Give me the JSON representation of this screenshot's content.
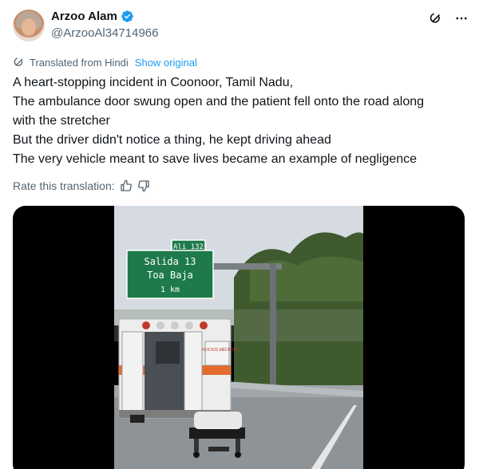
{
  "author": {
    "display_name": "Arzoo Alam",
    "handle": "@ArzooAl34714966",
    "avatar_icon": "avatar-photo",
    "verified_icon": "verified-badge-icon",
    "verified_color": "#1d9bf0"
  },
  "translation": {
    "label": "Translated from Hindi",
    "show_original": "Show original",
    "icon": "translate-icon"
  },
  "tweet": {
    "lines": [
      "A heart-stopping incident in Coonoor, Tamil Nadu,",
      "The ambulance door swung open and the patient fell onto the road along",
      "with the stretcher",
      "But the driver didn't notice a thing, he kept driving ahead",
      "The very vehicle meant to save lives became an example of negligence"
    ]
  },
  "rating": {
    "label": "Rate this translation:",
    "thumbs_up_icon": "thumbs-up-icon",
    "thumbs_down_icon": "thumbs-down-icon"
  },
  "media": {
    "sign": {
      "exit_tag": "Ali 132",
      "line1": "Salida 13",
      "line2": "Toa Baja",
      "line3": "1 km",
      "color": "#1e7a4a"
    },
    "ambulance_text": "SERVICIOS MÉDICOS"
  },
  "actions": {
    "grok_icon": "grok-icon",
    "more_icon": "more-icon"
  },
  "colors": {
    "text": "#0f1419",
    "secondary": "#536471",
    "link": "#1d9bf0"
  }
}
